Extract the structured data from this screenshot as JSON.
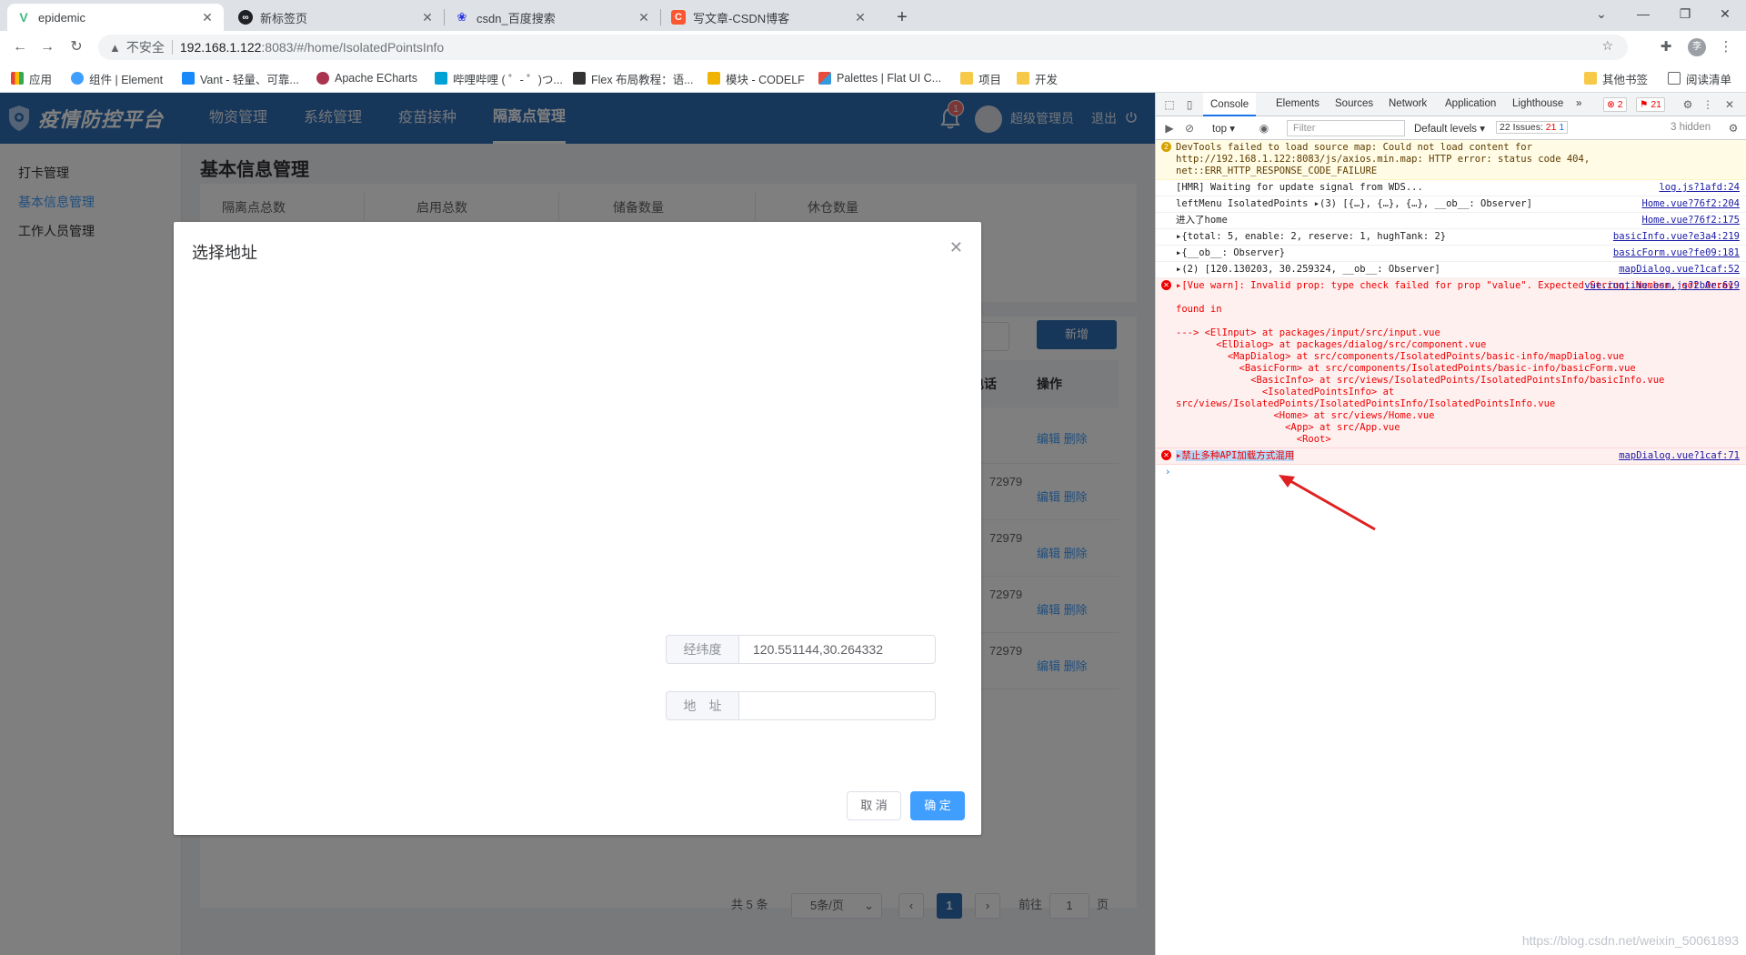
{
  "browser": {
    "tabs": [
      {
        "title": "epidemic",
        "icon": "vue-icon",
        "color": "#41b883",
        "glyph": "V"
      },
      {
        "title": "新标签页",
        "icon": "chrome-new-tab-icon",
        "color": "#202124",
        "glyph": "∞"
      },
      {
        "title": "csdn_百度搜索",
        "icon": "baidu-icon",
        "color": "#2932e1",
        "glyph": "❀"
      },
      {
        "title": "写文章-CSDN博客",
        "icon": "csdn-icon",
        "color": "#fc5531",
        "glyph": "C"
      }
    ],
    "url_security": "不安全",
    "url_host": "192.168.1.122",
    "url_path": ":8083/#/home/IsolatedPointsInfo",
    "profile_initial": "李",
    "bookmarks": [
      {
        "label": "应用",
        "color": "#ea4335"
      },
      {
        "label": "组件 | Element",
        "color": "#409eff"
      },
      {
        "label": "Vant - 轻量、可靠...",
        "color": "#1989fa"
      },
      {
        "label": "Apache ECharts",
        "color": "#aa344d"
      },
      {
        "label": "哔哩哔哩 ( ゜- ゜)つ...",
        "color": "#00a1d6"
      },
      {
        "label": "Flex 布局教程：语...",
        "color": "#333333"
      },
      {
        "label": "模块 - CODELF",
        "color": "#f0b400"
      },
      {
        "label": "Palettes | Flat UI C...",
        "color": "#e74c3c"
      },
      {
        "label": "项目",
        "color": "#f7c948"
      },
      {
        "label": "开发",
        "color": "#f7c948"
      }
    ],
    "other_bookmarks": "其他书签",
    "reading_list": "阅读清单"
  },
  "app": {
    "logo_text": "疫情防控平台",
    "nav": [
      "物资管理",
      "系统管理",
      "疫苗接种",
      "隔离点管理"
    ],
    "notification_count": "1",
    "user_name": "超级管理员",
    "logout_label": "退出",
    "sidebar": [
      "打卡管理",
      "基本信息管理",
      "工作人员管理"
    ],
    "page_title": "基本信息管理",
    "stats": [
      "隔离点总数",
      "启用总数",
      "储备数量",
      "休仓数量"
    ],
    "add_button": "新增",
    "table_headers": [
      "电话",
      "操作"
    ],
    "rows": [
      {
        "phone": "",
        "ops": "编辑 删除"
      },
      {
        "phone": "72979",
        "ops": "编辑 删除"
      },
      {
        "phone": "72979",
        "ops": "编辑 删除"
      },
      {
        "phone": "72979",
        "ops": "编辑 删除"
      },
      {
        "phone": "72979",
        "ops": "编辑 删除"
      }
    ],
    "pagination": {
      "total": "共 5 条",
      "page_size": "5条/页",
      "current_page": "1",
      "goto_label": "前往",
      "goto_value": "1",
      "page_suffix": "页"
    },
    "dialog": {
      "title": "选择地址",
      "lnglat_label": "经纬度",
      "lnglat_value": "120.551144,30.264332",
      "address_label": "地　址",
      "address_value": "",
      "cancel": "取 消",
      "confirm": "确 定"
    }
  },
  "devtools": {
    "tabs": [
      "Console",
      "Elements",
      "Sources",
      "Network",
      "Application",
      "Lighthouse"
    ],
    "error_count": "2",
    "warning_count": "21",
    "context": "top",
    "filter_placeholder": "Filter",
    "levels": "Default levels",
    "issues_label": "22 Issues:",
    "issues_err": "21",
    "issues_info": "1",
    "hidden": "3 hidden",
    "messages": [
      {
        "type": "warn",
        "badge": "2",
        "text": "DevTools failed to load source map: Could not load content for http://192.168.1.122:8083/js/axios.min.map: HTTP error: status code 404, net::ERR_HTTP_RESPONSE_CODE_FAILURE",
        "src": ""
      },
      {
        "type": "log",
        "text": "[HMR] Waiting for update signal from WDS...",
        "src": "log.js?1afd:24"
      },
      {
        "type": "log",
        "text": "leftMenu IsolatedPoints ▸(3) [{…}, {…}, {…}, __ob__: Observer]",
        "src": "Home.vue?76f2:204"
      },
      {
        "type": "log",
        "text": "进入了home",
        "src": "Home.vue?76f2:175"
      },
      {
        "type": "log",
        "text": "▸{total: 5, enable: 2, reserve: 1, hughTank: 2}",
        "src": "basicInfo.vue?e3a4:219"
      },
      {
        "type": "log",
        "text": "▸{__ob__: Observer}",
        "src": "basicForm.vue?fe09:181"
      },
      {
        "type": "log",
        "text": "▸(2) [120.130203, 30.259324, __ob__: Observer]",
        "src": "mapDialog.vue?1caf:52"
      },
      {
        "type": "err",
        "text": "▸[Vue warn]: Invalid prop: type check failed for prop \"value\". Expected String, Number, got Array\n\nfound in\n\n---> <ElInput> at packages/input/src/input.vue\n       <ElDialog> at packages/dialog/src/component.vue\n         <MapDialog> at src/components/IsolatedPoints/basic-info/mapDialog.vue\n           <BasicForm> at src/components/IsolatedPoints/basic-info/basicForm.vue\n             <BasicInfo> at src/views/IsolatedPoints/IsolatedPointsInfo/basicInfo.vue\n               <IsolatedPointsInfo> at\nsrc/views/IsolatedPoints/IsolatedPointsInfo/IsolatedPointsInfo.vue\n                 <Home> at src/views/Home.vue\n                   <App> at src/App.vue\n                     <Root>",
        "src": "vue.runtime.esm.js?2b0e:619"
      },
      {
        "type": "err",
        "text": "▸禁止多种API加载方式混用",
        "src": "mapDialog.vue?1caf:71"
      }
    ],
    "watermark": "https://blog.csdn.net/weixin_50061893"
  }
}
